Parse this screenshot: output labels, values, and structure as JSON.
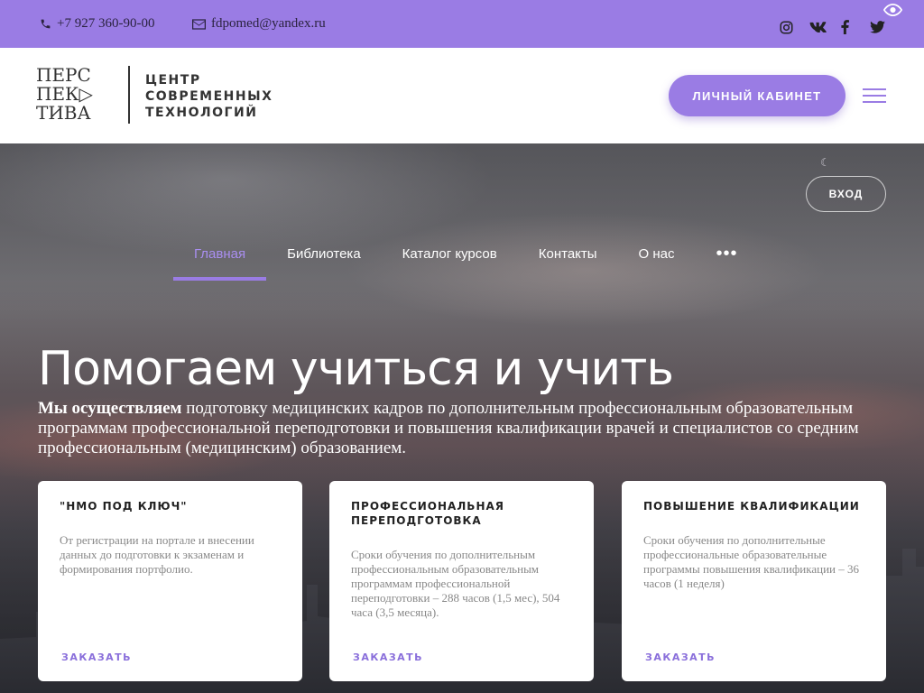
{
  "colors": {
    "accent": "#9a7ce4",
    "topbar": "#9a7ce4",
    "active_nav": "#a98ef0"
  },
  "topbar": {
    "phone": "+7 927 360-90-00",
    "email": "fdpomed@yandex.ru",
    "phone_icon": "phone-icon",
    "email_icon": "envelope-icon",
    "social": [
      "instagram-icon",
      "vk-icon",
      "facebook-icon",
      "twitter-icon"
    ],
    "accessibility_icon": "eye-icon"
  },
  "header": {
    "logo_mark_lines": [
      "ПЕРС",
      "ПЕК▷",
      "ТИВА"
    ],
    "logo_text_lines": [
      "ЦЕНТР",
      "СОВРЕМЕННЫХ",
      "ТЕХНОЛОГИЙ"
    ],
    "cabinet_button": "ЛИЧНЫЙ КАБИНЕТ",
    "menu_icon": "hamburger-icon"
  },
  "hero": {
    "login_button": "ВХОД",
    "nav": [
      {
        "label": "Главная",
        "active": true
      },
      {
        "label": "Библиотека",
        "active": false
      },
      {
        "label": "Каталог курсов",
        "active": false
      },
      {
        "label": "Контакты",
        "active": false
      },
      {
        "label": "О нас",
        "active": false
      }
    ],
    "nav_more": "•••",
    "title": "Помогаем учиться и учить",
    "desc_bold": "Мы осуществляем",
    "desc_rest": " подготовку медицинских кадров по дополнительным профессиональным образовательным программам профессиональной переподготовки и повышения квалификации врачей и специалистов со средним профессиональным (медицинским) образованием."
  },
  "cards": [
    {
      "title": "\"НМО ПОД КЛЮЧ\"",
      "text": "От регистрации на портале и внесении данных до подготовки к экзаменам и формирования портфолио.",
      "link": "ЗАКАЗАТЬ"
    },
    {
      "title": "ПРОФЕССИОНАЛЬНАЯ ПЕРЕПОДГОТОВКА",
      "text": "Сроки обучения по дополнительным профессиональным образовательным программам профессиональной переподготовки – 288 часов (1,5 мес), 504 часа (3,5 месяца).",
      "link": "ЗАКАЗАТЬ"
    },
    {
      "title": "ПОВЫШЕНИЕ КВАЛИФИКАЦИИ",
      "text": "Сроки обучения по дополнительные профессиональные образовательные программы повышения квалификации – 36 часов (1 неделя)",
      "link": "ЗАКАЗАТЬ"
    }
  ]
}
